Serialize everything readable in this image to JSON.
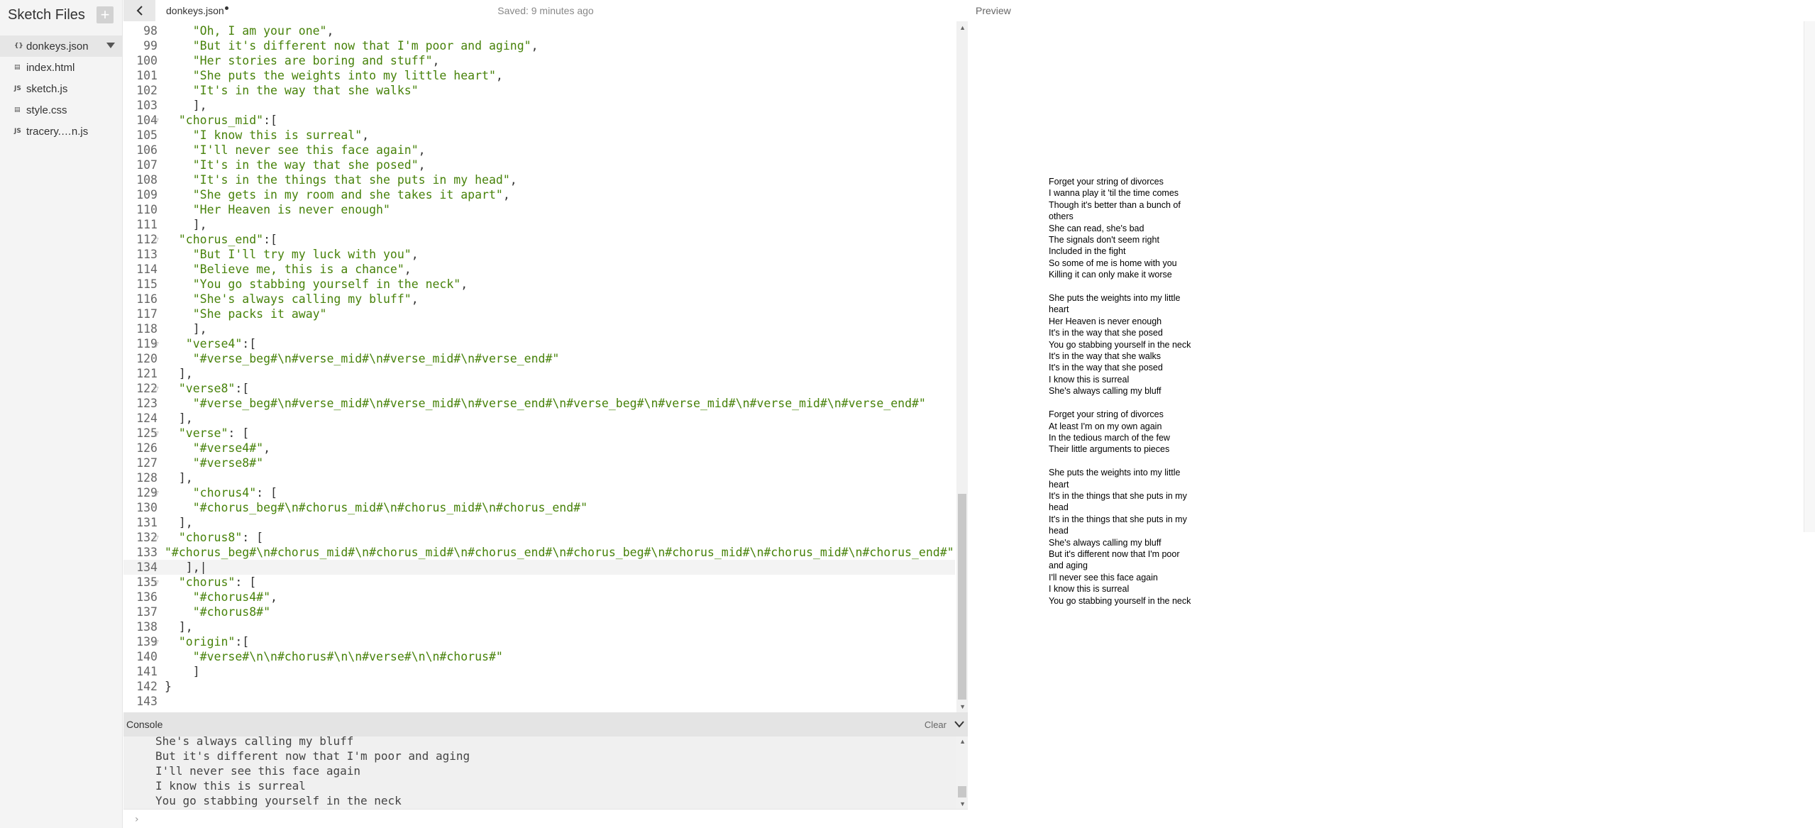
{
  "sidebar": {
    "title": "Sketch Files",
    "add_icon": "plus-icon",
    "files": [
      {
        "name": "donkeys.json",
        "icon": "{}",
        "active": true
      },
      {
        "name": "index.html",
        "icon": "▤",
        "active": false
      },
      {
        "name": "sketch.js",
        "icon": "JS",
        "active": false
      },
      {
        "name": "style.css",
        "icon": "▤",
        "active": false
      },
      {
        "name": "tracery.…n.js",
        "icon": "JS",
        "active": false
      }
    ]
  },
  "editor": {
    "file_name": "donkeys.json",
    "save_status": "Saved: 9 minutes ago",
    "current_line": 134,
    "lines": [
      {
        "n": 98,
        "text": "    \"Oh, I am your one\","
      },
      {
        "n": 99,
        "text": "    \"But it's different now that I'm poor and aging\","
      },
      {
        "n": 100,
        "text": "    \"Her stories are boring and stuff\","
      },
      {
        "n": 101,
        "text": "    \"She puts the weights into my little heart\","
      },
      {
        "n": 102,
        "text": "    \"It's in the way that she walks\""
      },
      {
        "n": 103,
        "text": "    ],"
      },
      {
        "n": 104,
        "text": "  \"chorus_mid\":[",
        "fold": true
      },
      {
        "n": 105,
        "text": "    \"I know this is surreal\","
      },
      {
        "n": 106,
        "text": "    \"I'll never see this face again\","
      },
      {
        "n": 107,
        "text": "    \"It's in the way that she posed\","
      },
      {
        "n": 108,
        "text": "    \"It's in the things that she puts in my head\","
      },
      {
        "n": 109,
        "text": "    \"She gets in my room and she takes it apart\","
      },
      {
        "n": 110,
        "text": "    \"Her Heaven is never enough\""
      },
      {
        "n": 111,
        "text": "    ],"
      },
      {
        "n": 112,
        "text": "  \"chorus_end\":[",
        "fold": true
      },
      {
        "n": 113,
        "text": "    \"But I'll try my luck with you\","
      },
      {
        "n": 114,
        "text": "    \"Believe me, this is a chance\","
      },
      {
        "n": 115,
        "text": "    \"You go stabbing yourself in the neck\","
      },
      {
        "n": 116,
        "text": "    \"She's always calling my bluff\","
      },
      {
        "n": 117,
        "text": "    \"She packs it away\""
      },
      {
        "n": 118,
        "text": "    ],"
      },
      {
        "n": 119,
        "text": "   \"verse4\":[",
        "fold": true
      },
      {
        "n": 120,
        "text": "    \"#verse_beg#\\n#verse_mid#\\n#verse_mid#\\n#verse_end#\""
      },
      {
        "n": 121,
        "text": "  ],"
      },
      {
        "n": 122,
        "text": "  \"verse8\":[",
        "fold": true
      },
      {
        "n": 123,
        "text": "    \"#verse_beg#\\n#verse_mid#\\n#verse_mid#\\n#verse_end#\\n#verse_beg#\\n#verse_mid#\\n#verse_mid#\\n#verse_end#\""
      },
      {
        "n": 124,
        "text": "  ],"
      },
      {
        "n": 125,
        "text": "  \"verse\": [",
        "fold": true
      },
      {
        "n": 126,
        "text": "    \"#verse4#\","
      },
      {
        "n": 127,
        "text": "    \"#verse8#\""
      },
      {
        "n": 128,
        "text": "  ],"
      },
      {
        "n": 129,
        "text": "    \"chorus4\": [",
        "fold": true
      },
      {
        "n": 130,
        "text": "    \"#chorus_beg#\\n#chorus_mid#\\n#chorus_mid#\\n#chorus_end#\""
      },
      {
        "n": 131,
        "text": "  ],"
      },
      {
        "n": 132,
        "text": "  \"chorus8\": [",
        "fold": true
      },
      {
        "n": 133,
        "text": "\"#chorus_beg#\\n#chorus_mid#\\n#chorus_mid#\\n#chorus_end#\\n#chorus_beg#\\n#chorus_mid#\\n#chorus_mid#\\n#chorus_end#\""
      },
      {
        "n": 134,
        "text": "   ],|"
      },
      {
        "n": 135,
        "text": "  \"chorus\": [",
        "fold": true
      },
      {
        "n": 136,
        "text": "    \"#chorus4#\","
      },
      {
        "n": 137,
        "text": "    \"#chorus8#\""
      },
      {
        "n": 138,
        "text": "  ],"
      },
      {
        "n": 139,
        "text": "  \"origin\":[",
        "fold": true
      },
      {
        "n": 140,
        "text": "    \"#verse#\\n\\n#chorus#\\n\\n#verse#\\n\\n#chorus#\""
      },
      {
        "n": 141,
        "text": "    ]"
      },
      {
        "n": 142,
        "text": "}"
      },
      {
        "n": 143,
        "text": ""
      }
    ]
  },
  "console": {
    "title": "Console",
    "clear_label": "Clear",
    "prompt": "›",
    "lines": [
      "She's always calling my bluff",
      "But it's different now that I'm poor and aging",
      "I'll never see this face again",
      "I know this is surreal",
      "You go stabbing yourself in the neck"
    ]
  },
  "preview": {
    "title": "Preview",
    "stanzas": [
      [
        "Forget your string of divorces",
        "I wanna play it 'til the time comes",
        "Though it's better than a bunch of",
        "others",
        "She can read, she's bad",
        "The signals don't seem right",
        "Included in the fight",
        "So some of me is home with you",
        "Killing it can only make it worse"
      ],
      [
        "She puts the weights into my little",
        "heart",
        "Her Heaven is never enough",
        "It's in the way that she posed",
        "You go stabbing yourself in the neck",
        "It's in the way that she walks",
        "It's in the way that she posed",
        "I know this is surreal",
        "She's always calling my bluff"
      ],
      [
        "Forget your string of divorces",
        "At least I'm on my own again",
        "In the tedious march of the few",
        "Their little arguments to pieces"
      ],
      [
        "She puts the weights into my little",
        "heart",
        "It's in the things that she puts in my",
        "head",
        "It's in the things that she puts in my",
        "head",
        "She's always calling my bluff",
        "But it's different now that I'm poor",
        "and aging",
        "I'll never see this face again",
        "I know this is surreal",
        "You go stabbing yourself in the neck"
      ]
    ]
  },
  "colors": {
    "string": "#47820a",
    "sidebar_bg": "#f4f4f4",
    "console_bg": "#f0f0f0"
  }
}
